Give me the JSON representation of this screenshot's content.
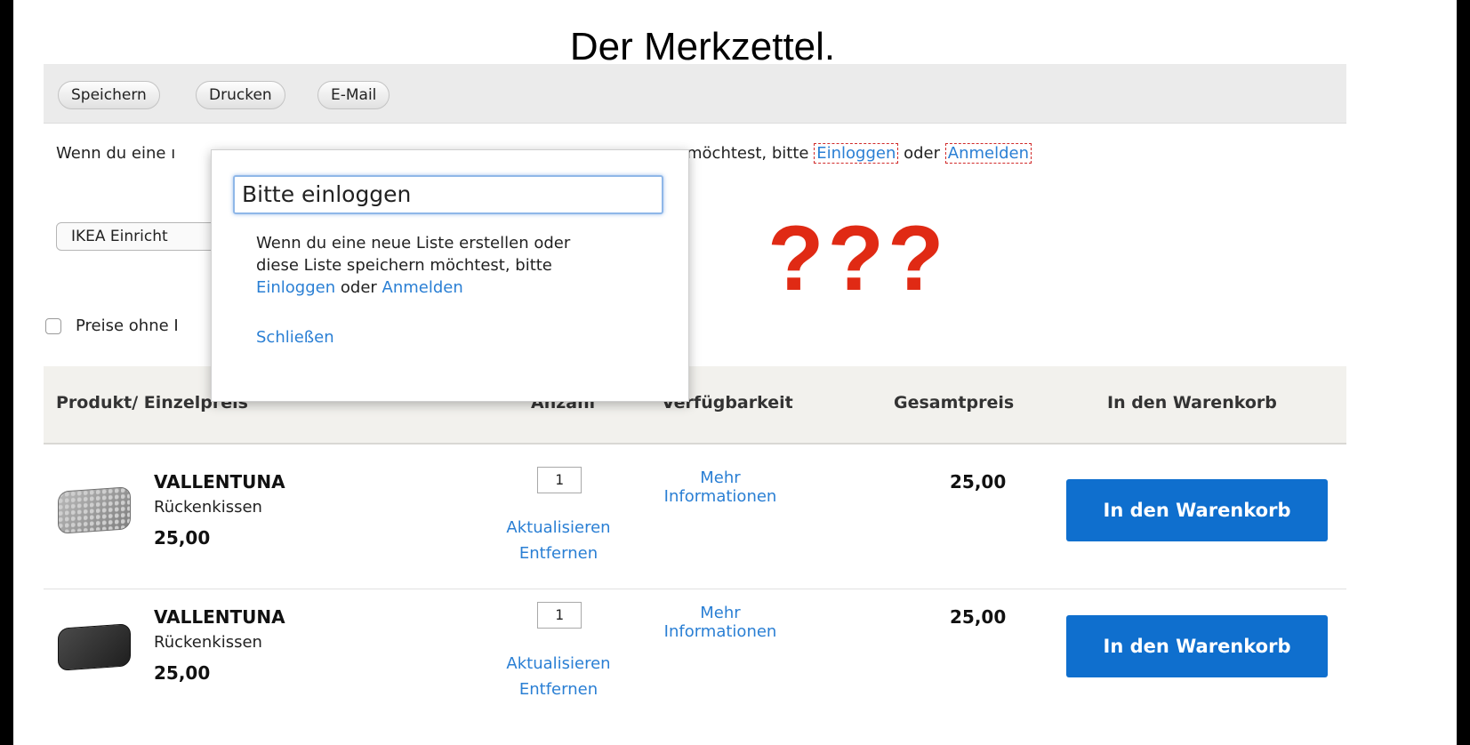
{
  "slide": {
    "title": "Der Merkzettel.",
    "annotation": "???"
  },
  "toolbar": {
    "buttons": [
      "Speichern",
      "Drucken",
      "E-Mail"
    ]
  },
  "info": {
    "prefix": "Wenn du eine ı",
    "suffix": "möchtest, bitte",
    "login_link": "Einloggen",
    "or_text": "oder",
    "register_link": "Anmelden"
  },
  "list_select": {
    "value": "IKEA Einricht"
  },
  "price_toggle": {
    "label": "Preise ohne I",
    "checked": false
  },
  "table": {
    "headers": {
      "product": "Produkt/ Einzelpreis",
      "quantity": "Anzahl",
      "availability": "Verfügbarkeit",
      "total": "Gesamtpreis",
      "cart": "In den Warenkorb"
    },
    "rows": [
      {
        "name": "VALLENTUNA",
        "desc": "Rückenkissen",
        "price": "25,00",
        "qty": "1",
        "update": "Aktualisieren",
        "remove": "Entfernen",
        "avail_line1": "Mehr",
        "avail_line2": "Informationen",
        "total": "25,00",
        "cart_button": "In den Warenkorb",
        "thumb_color": "grey"
      },
      {
        "name": "VALLENTUNA",
        "desc": "Rückenkissen",
        "price": "25,00",
        "qty": "1",
        "update": "Aktualisieren",
        "remove": "Entfernen",
        "avail_line1": "Mehr",
        "avail_line2": "Informationen",
        "total": "25,00",
        "cart_button": "In den Warenkorb",
        "thumb_color": "black"
      }
    ]
  },
  "popup": {
    "title": "Bitte einloggen",
    "text_line1": "Wenn du eine neue Liste erstellen oder",
    "text_line2": "diese Liste speichern möchtest, bitte",
    "login_link": "Einloggen",
    "or_text": "oder",
    "register_link": "Anmelden",
    "close": "Schließen"
  },
  "colors": {
    "link": "#2a7fd4",
    "cart_button": "#0f6fce",
    "annotation": "#e02a14"
  }
}
